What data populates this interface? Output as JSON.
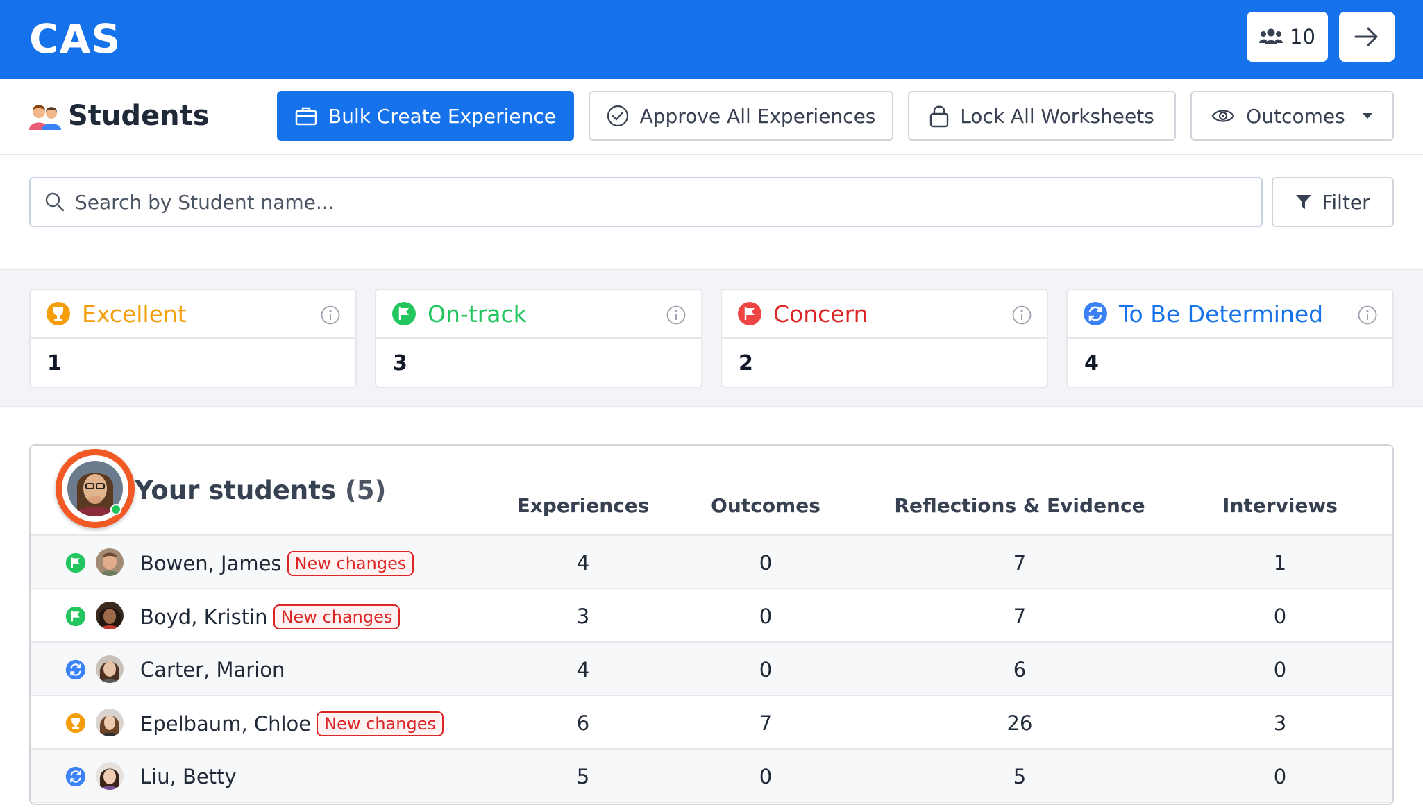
{
  "app": {
    "title": "CAS",
    "user_count": "10"
  },
  "toolbar": {
    "title": "Students",
    "bulk_create": "Bulk Create Experience",
    "approve_all": "Approve All Experiences",
    "lock_all": "Lock All Worksheets",
    "outcomes": "Outcomes"
  },
  "search": {
    "placeholder": "Search by Student name...",
    "filter_label": "Filter"
  },
  "stats": [
    {
      "label": "Excellent",
      "value": "1",
      "color": "#f59e0b",
      "icon": "trophy-icon"
    },
    {
      "label": "On-track",
      "value": "3",
      "color": "#22c55e",
      "icon": "flag-icon"
    },
    {
      "label": "Concern",
      "value": "2",
      "color": "#ef4444",
      "icon": "flag-icon"
    },
    {
      "label": "To Be Determined",
      "value": "4",
      "color": "#3b82f6",
      "icon": "refresh-icon"
    }
  ],
  "table": {
    "title": "Your students",
    "count": "(5)",
    "columns": [
      "Experiences",
      "Outcomes",
      "Reflections & Evidence",
      "Interviews"
    ],
    "badge_label": "New changes",
    "rows": [
      {
        "status": "on-track",
        "name": "Bowen, James",
        "new_changes": true,
        "experiences": "4",
        "outcomes": "0",
        "reflections": "7",
        "interviews": "1"
      },
      {
        "status": "on-track",
        "name": "Boyd, Kristin",
        "new_changes": true,
        "experiences": "3",
        "outcomes": "0",
        "reflections": "7",
        "interviews": "0"
      },
      {
        "status": "tbd",
        "name": "Carter, Marion",
        "new_changes": false,
        "experiences": "4",
        "outcomes": "0",
        "reflections": "6",
        "interviews": "0"
      },
      {
        "status": "excellent",
        "name": "Epelbaum, Chloe",
        "new_changes": true,
        "experiences": "6",
        "outcomes": "7",
        "reflections": "26",
        "interviews": "3"
      },
      {
        "status": "tbd",
        "name": "Liu, Betty",
        "new_changes": false,
        "experiences": "5",
        "outcomes": "0",
        "reflections": "5",
        "interviews": "0"
      }
    ]
  }
}
